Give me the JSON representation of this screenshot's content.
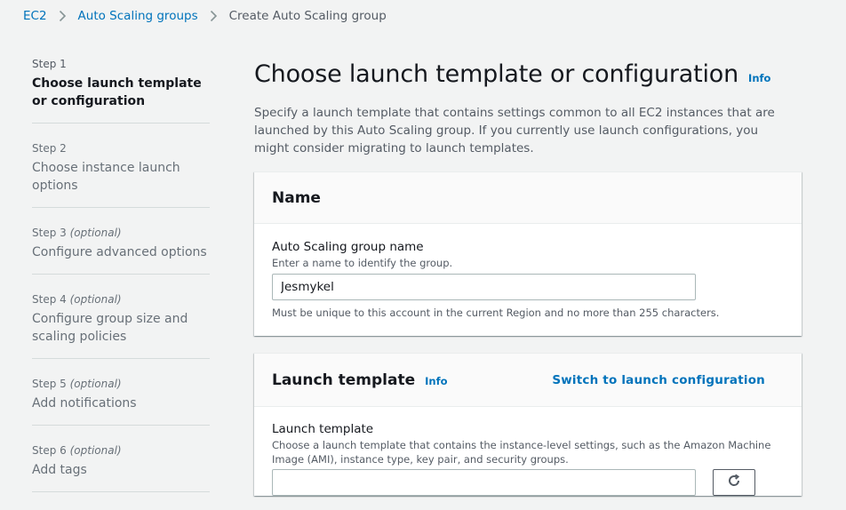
{
  "breadcrumb": {
    "items": [
      "EC2",
      "Auto Scaling groups"
    ],
    "current": "Create Auto Scaling group"
  },
  "steps": [
    {
      "number": "Step 1",
      "optional": "",
      "title": "Choose launch template or configuration",
      "active": true
    },
    {
      "number": "Step 2",
      "optional": "",
      "title": "Choose instance launch options",
      "active": false
    },
    {
      "number": "Step 3",
      "optional": "(optional)",
      "title": "Configure advanced options",
      "active": false
    },
    {
      "number": "Step 4",
      "optional": "(optional)",
      "title": "Configure group size and scaling policies",
      "active": false
    },
    {
      "number": "Step 5",
      "optional": "(optional)",
      "title": "Add notifications",
      "active": false
    },
    {
      "number": "Step 6",
      "optional": "(optional)",
      "title": "Add tags",
      "active": false
    }
  ],
  "main": {
    "title": "Choose launch template or configuration",
    "info_label": "Info",
    "description": "Specify a launch template that contains settings common to all EC2 instances that are launched by this Auto Scaling group. If you currently use launch configurations, you might consider migrating to launch templates."
  },
  "name_panel": {
    "title": "Name",
    "field_label": "Auto Scaling group name",
    "field_desc": "Enter a name to identify the group.",
    "value": "Jesmykel",
    "constraint": "Must be unique to this account in the current Region and no more than 255 characters."
  },
  "launch_panel": {
    "title": "Launch template",
    "info_label": "Info",
    "switch_label": "Switch to launch configuration",
    "field_label": "Launch template",
    "field_desc": "Choose a launch template that contains the instance-level settings, such as the Amazon Machine Image (AMI), instance type, key pair, and security groups."
  },
  "colors": {
    "link": "#0073bb",
    "background": "#f2f3f3",
    "panel": "#ffffff"
  },
  "icons": [
    "chevron-right-icon",
    "refresh-icon"
  ]
}
